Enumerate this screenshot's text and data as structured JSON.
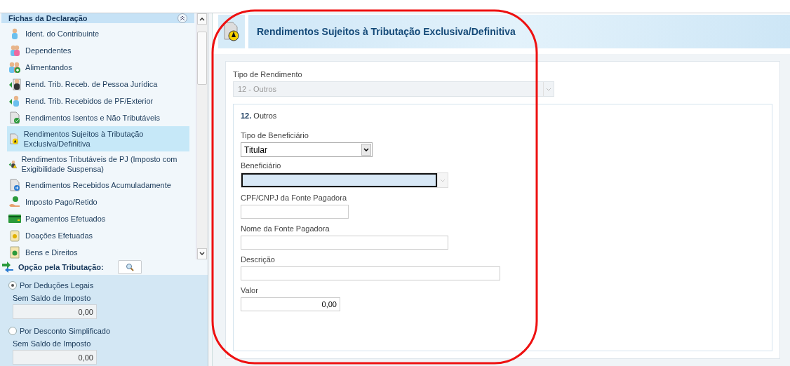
{
  "sidebar": {
    "title": "Fichas da Declaração",
    "items": [
      {
        "label": "Ident. do Contribuinte",
        "selected": false
      },
      {
        "label": "Dependentes",
        "selected": false
      },
      {
        "label": "Alimentandos",
        "selected": false
      },
      {
        "label": "Rend. Trib. Receb. de Pessoa Jurídica",
        "selected": false
      },
      {
        "label": "Rend. Trib. Recebidos de PF/Exterior",
        "selected": false
      },
      {
        "label": "Rendimentos Isentos e Não Tributáveis",
        "selected": false
      },
      {
        "label": "Rendimentos Sujeitos à Tributação Exclusiva/Definitiva",
        "selected": true
      },
      {
        "label": "Rendimentos Tributáveis de PJ (Imposto com Exigibilidade Suspensa)",
        "selected": false
      },
      {
        "label": "Rendimentos Recebidos Acumuladamente",
        "selected": false
      },
      {
        "label": "Imposto Pago/Retido",
        "selected": false
      },
      {
        "label": "Pagamentos Efetuados",
        "selected": false
      },
      {
        "label": "Doações Efetuadas",
        "selected": false
      },
      {
        "label": "Bens e Direitos",
        "selected": false
      }
    ]
  },
  "taxation": {
    "title": "Opção pela Tributação:",
    "options": [
      {
        "label": "Por Deduções Legais",
        "selected": true,
        "sublabel": "Sem Saldo de Imposto",
        "value": "0,00"
      },
      {
        "label": "Por Desconto Simplificado",
        "selected": false,
        "sublabel": "Sem Saldo de Imposto",
        "value": "0,00"
      }
    ]
  },
  "main": {
    "title": "Rendimentos Sujeitos à Tributação Exclusiva/Definitiva",
    "income_type": {
      "label": "Tipo de Rendimento",
      "value": "12 - Outros",
      "disabled": true
    },
    "section": {
      "number": "12.",
      "title": "Outros",
      "fields": [
        {
          "kind": "select",
          "label": "Tipo de Beneficiário",
          "value": "Titular"
        },
        {
          "kind": "focused-select",
          "label": "Beneficiário"
        },
        {
          "kind": "text",
          "label": "CPF/CNPJ da Fonte Pagadora"
        },
        {
          "kind": "text",
          "label": "Nome da Fonte Pagadora"
        },
        {
          "kind": "text",
          "label": "Descrição"
        },
        {
          "kind": "number",
          "label": "Valor",
          "value": "0,00"
        }
      ]
    }
  }
}
